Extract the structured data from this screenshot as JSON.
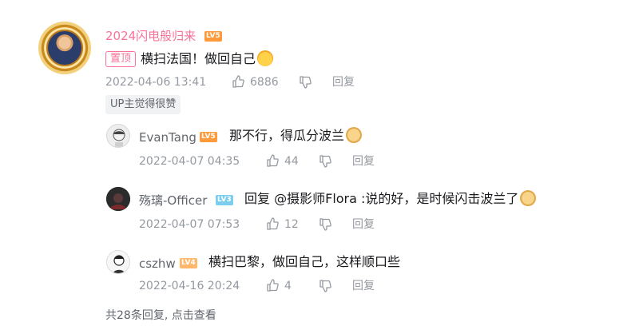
{
  "main_comment": {
    "username": "2024闪电般归来",
    "level": "LV5",
    "pin_label": "置顶",
    "text": "横扫法国！做回自己",
    "emoji": "shocked-face-emoji",
    "date": "2022-04-06 13:41",
    "likes": "6886",
    "reply_label": "回复",
    "up_badge": "UP主觉得很赞"
  },
  "replies": [
    {
      "username": "EvanTang",
      "level": "LV5",
      "text": "那不行，得瓜分波兰",
      "emoji": "doge-emoji",
      "date": "2022-04-07 04:35",
      "likes": "44",
      "reply_label": "回复"
    },
    {
      "username": "殇璃-Officer",
      "level": "LV3",
      "reply_prefix": "回复",
      "mention": "@摄影师Flora",
      "text": ":说的好，是时候闪击波兰了",
      "emoji": "doge-emoji",
      "date": "2022-04-07 07:53",
      "likes": "12",
      "reply_label": "回复"
    },
    {
      "username": "cszhw",
      "level": "LV4",
      "text": "横扫巴黎，做回自己，这样顺口些",
      "date": "2022-04-16 20:24",
      "likes": "4",
      "reply_label": "回复"
    }
  ],
  "footer": {
    "summary": "共28条回复, 点击查看"
  },
  "colors": {
    "username_pink": "#fb7299",
    "meta_grey": "#9499a0",
    "level5": "#ff9a3c",
    "level3": "#7bcdee"
  }
}
